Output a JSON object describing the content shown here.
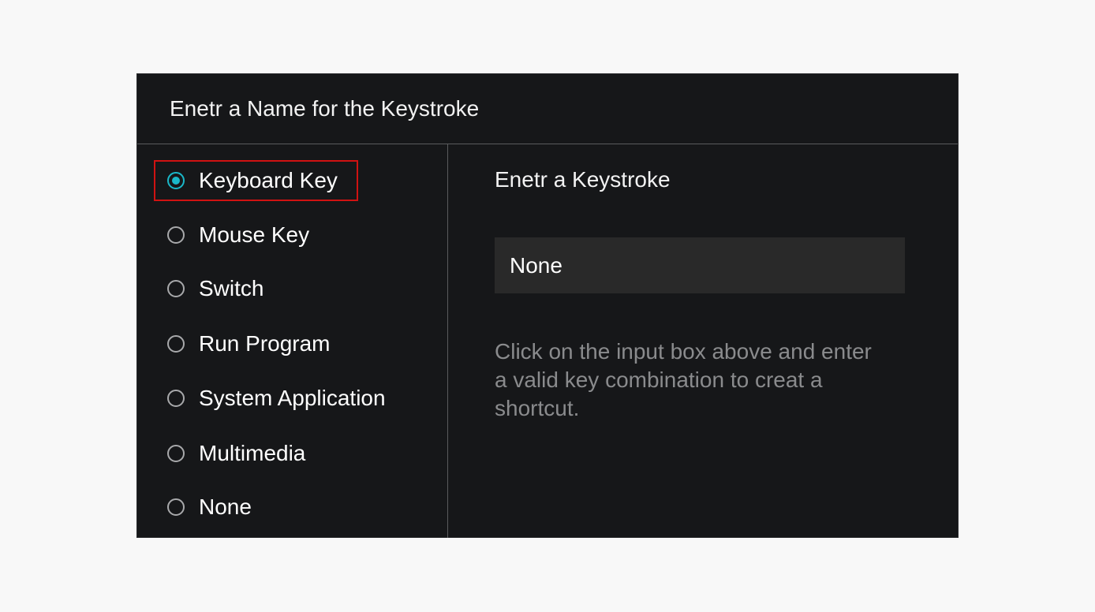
{
  "dialog": {
    "title": "Enetr a Name for the Keystroke"
  },
  "options": [
    {
      "label": "Keyboard Key",
      "selected": true
    },
    {
      "label": "Mouse Key",
      "selected": false
    },
    {
      "label": "Switch",
      "selected": false
    },
    {
      "label": "Run Program",
      "selected": false
    },
    {
      "label": "System Application",
      "selected": false
    },
    {
      "label": "Multimedia",
      "selected": false
    },
    {
      "label": "None",
      "selected": false
    }
  ],
  "keystroke": {
    "title": "Enetr a Keystroke",
    "value": "None",
    "hint": "Click on the input box above and enter a valid key combination to creat a shortcut."
  },
  "colors": {
    "dialog_background": "#161719",
    "accent": "#1ab8c9",
    "highlight": "#d01212",
    "input_background": "#292929",
    "hint_text": "#8a8b8d"
  }
}
